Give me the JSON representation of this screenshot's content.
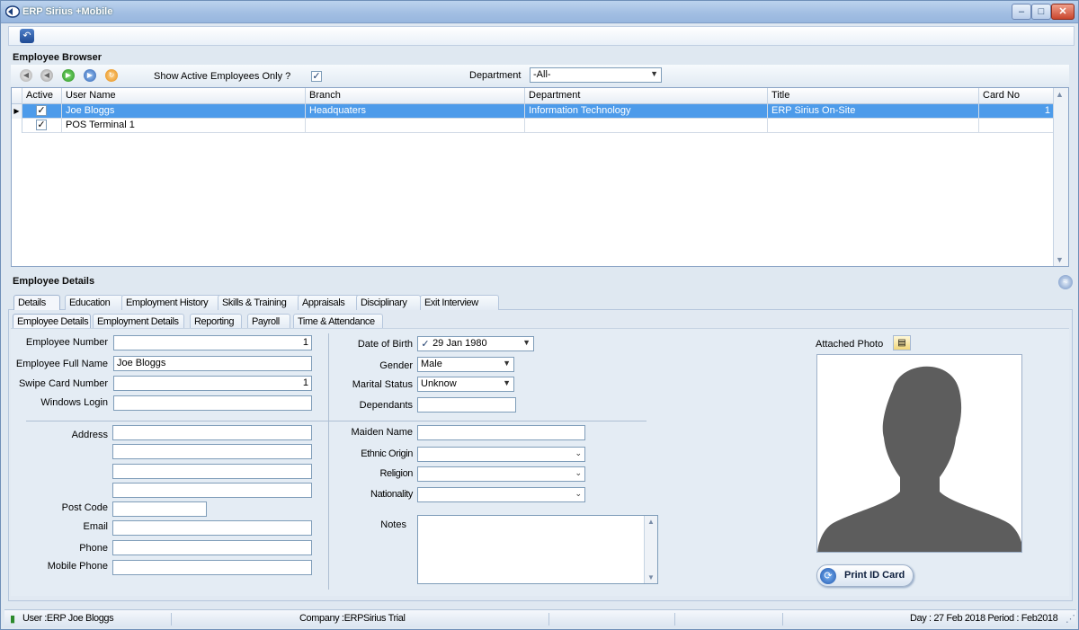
{
  "window": {
    "title": "ERP Sirius +Mobile",
    "min": "–",
    "max": "□",
    "close": "✕"
  },
  "toolbar": {
    "back_icon": "↶"
  },
  "browser": {
    "title": "Employee Browser",
    "nav": {
      "first": "◀",
      "prev": "◀",
      "next": "▶",
      "last": "▶",
      "refresh": "↻"
    },
    "active_only_label": "Show Active Employees Only ?",
    "active_only_checked": "✓",
    "department_label": "Department",
    "department_value": "-All-",
    "columns": [
      "Active",
      "User Name",
      "Branch",
      "Department",
      "Title",
      "Card No"
    ],
    "rows": [
      {
        "active": "✓",
        "user": "Joe Bloggs",
        "branch": "Headquaters",
        "department": "Information Technology",
        "title": "ERP Sirius On-Site",
        "card": "1",
        "indicator": "▶"
      },
      {
        "active": "✓",
        "user": "POS Terminal 1",
        "branch": "",
        "department": "",
        "title": "",
        "card": "",
        "indicator": ""
      }
    ]
  },
  "details": {
    "title": "Employee Details",
    "tabs": [
      "Details",
      "Education",
      "Employment History",
      "Skills & Training",
      "Appraisals",
      "Disciplinary",
      "Exit Interview"
    ],
    "subtabs": [
      "Employee Details",
      "Employment Details",
      "Reporting",
      "Payroll",
      "Time & Attendance"
    ],
    "fields": {
      "employee_number_label": "Employee Number",
      "employee_number": "1",
      "full_name_label": "Employee Full Name",
      "full_name": "Joe Bloggs",
      "swipe_label": "Swipe Card Number",
      "swipe": "1",
      "windows_login_label": "Windows Login",
      "windows_login": "",
      "address_label": "Address",
      "post_code_label": "Post Code",
      "email_label": "Email",
      "phone_label": "Phone",
      "mobile_label": "Mobile Phone",
      "dob_label": "Date of Birth",
      "dob": "29 Jan 1980",
      "dob_checked": "✓",
      "gender_label": "Gender",
      "gender": "Male",
      "marital_label": "Marital Status",
      "marital": "Unknow",
      "dependants_label": "Dependants",
      "maiden_label": "Maiden Name",
      "ethnic_label": "Ethnic Origin",
      "religion_label": "Religion",
      "nationality_label": "Nationality",
      "notes_label": "Notes"
    },
    "photo_label": "Attached Photo",
    "print_label": "Print ID Card"
  },
  "status": {
    "user": "User :ERP Joe Bloggs",
    "company": "Company :ERPSirius Trial",
    "day_period": "Day : 27 Feb 2018  Period : Feb2018"
  }
}
